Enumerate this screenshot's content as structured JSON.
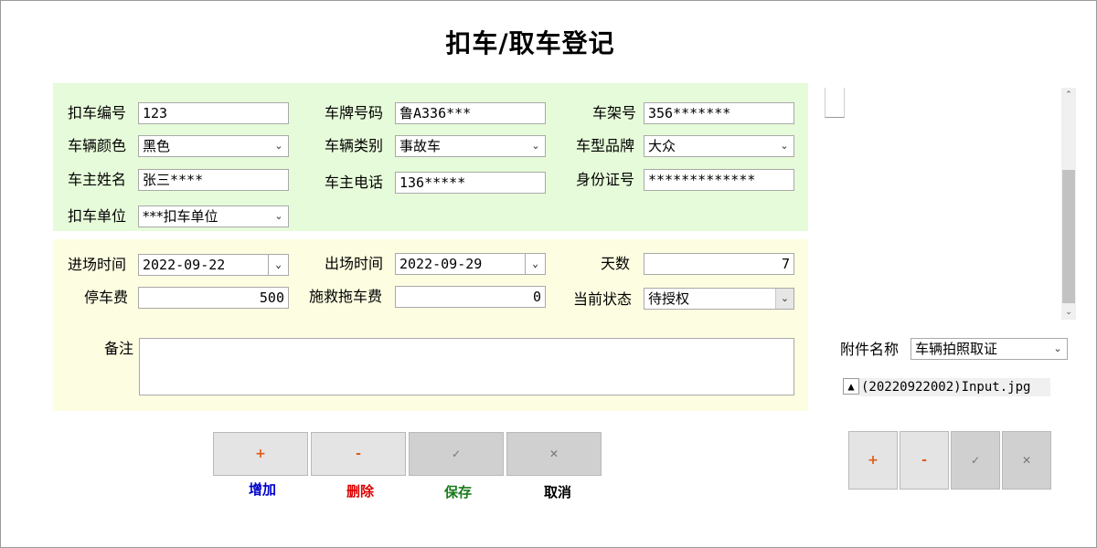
{
  "title": "扣车/取车登记",
  "form": {
    "vehicle_no_label": "扣车编号",
    "vehicle_no": "123",
    "plate_label": "车牌号码",
    "plate": "鲁A336***",
    "frame_label": "车架号",
    "frame_no": "356*******",
    "color_label": "车辆颜色",
    "color": "黑色",
    "type_label": "车辆类别",
    "type": "事故车",
    "brand_label": "车型品牌",
    "brand": "大众",
    "owner_label": "车主姓名",
    "owner": "张三****",
    "phone_label": "车主电话",
    "phone": "136*****",
    "id_label": "身份证号",
    "id_no": "*************",
    "unit_label": "扣车单位",
    "unit": "***扣车单位",
    "in_time_label": "进场时间",
    "in_time": "2022-09-22",
    "out_time_label": "出场时间",
    "out_time": "2022-09-29",
    "days_label": "天数",
    "days": "7",
    "parking_fee_label": "停车费",
    "parking_fee": "500",
    "tow_fee_label": "施救拖车费",
    "tow_fee": "0",
    "status_label": "当前状态",
    "status": "待授权",
    "remark_label": "备注",
    "remark": ""
  },
  "actions": {
    "add_label": "增加",
    "delete_label": "删除",
    "save_label": "保存",
    "cancel_label": "取消",
    "add_symbol": "+",
    "delete_symbol": "-",
    "save_symbol": "✓",
    "cancel_symbol": "✕"
  },
  "attachment": {
    "name_label": "附件名称",
    "name": "车辆拍照取证",
    "file": "(20220922002)Input.jpg",
    "file_icon": "triangle-up-icon"
  },
  "colors": {
    "green_panel": "#e6fbd9",
    "yellow_panel": "#fdfde1",
    "add": "#0000cc",
    "delete": "#dd0000",
    "save": "#1a7a1a",
    "cancel": "#000000",
    "plus_minus": "#e05a12"
  }
}
